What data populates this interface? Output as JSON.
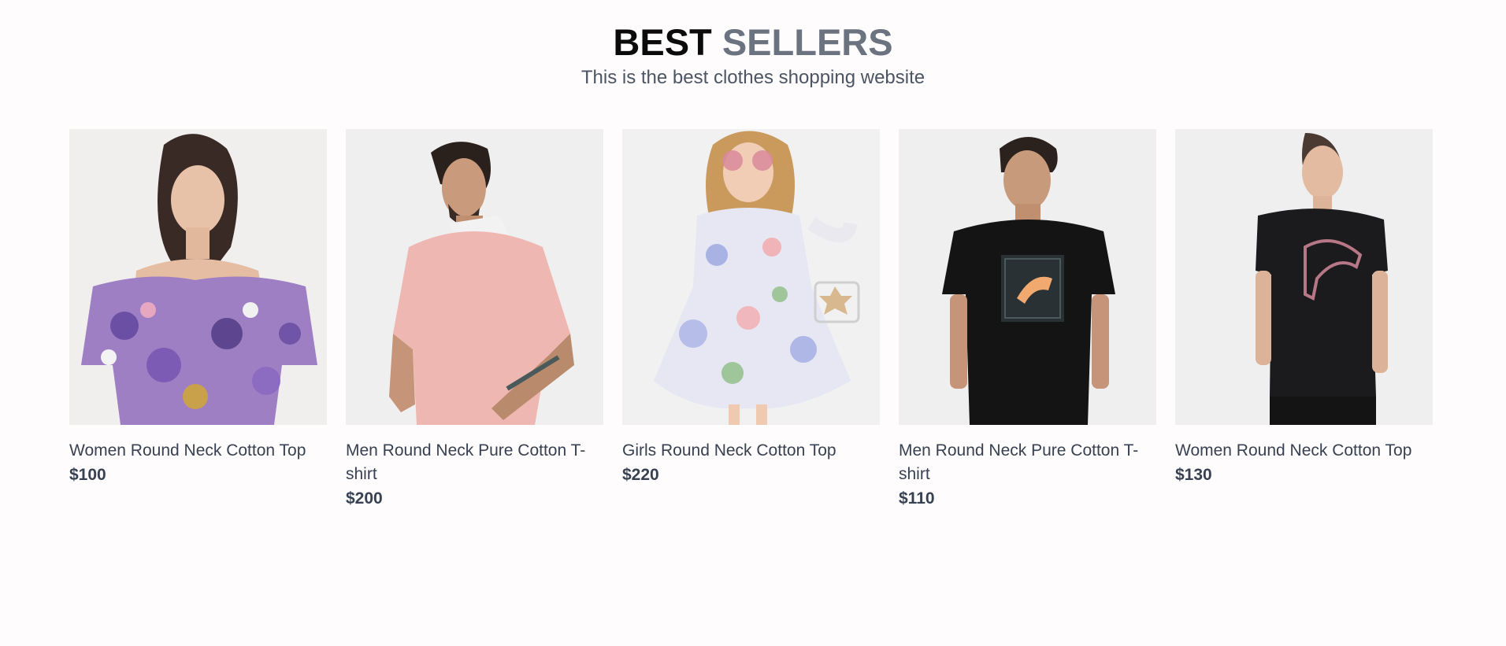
{
  "section": {
    "title_part1": "BEST",
    "title_part2": "SELLERS",
    "subtitle": "This is the best clothes shopping website"
  },
  "products": [
    {
      "name": "Women Round Neck Cotton Top",
      "price": "$100",
      "image": "woman-floral-offshoulder-top"
    },
    {
      "name": "Men Round Neck Pure Cotton T-shirt",
      "price": "$200",
      "image": "man-pink-polo"
    },
    {
      "name": "Girls Round Neck Cotton Top",
      "price": "$220",
      "image": "girl-floral-dress"
    },
    {
      "name": "Men Round Neck Pure Cotton T-shirt",
      "price": "$110",
      "image": "man-black-puma-tshirt"
    },
    {
      "name": "Women Round Neck Cotton Top",
      "price": "$130",
      "image": "woman-black-puma-tshirt"
    }
  ],
  "colors": {
    "title_dark": "#0b0b0b",
    "title_gray": "#6b7280",
    "text": "#374151",
    "photo_bg": "#efefef"
  }
}
